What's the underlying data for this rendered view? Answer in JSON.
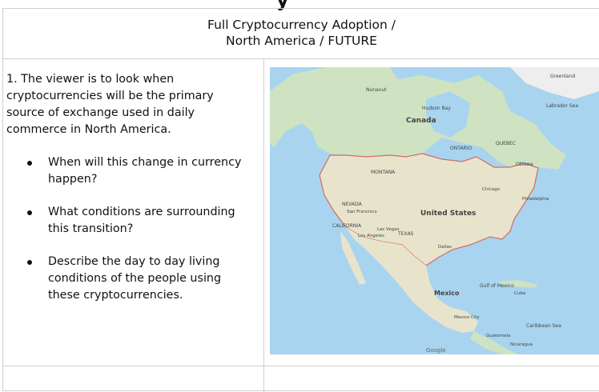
{
  "page": {
    "cutoff_heading": "y"
  },
  "header": {
    "title_line1": "Full Cryptocurrency Adoption /",
    "title_line2": "North America / FUTURE"
  },
  "prompt": {
    "intro": "1. The viewer is to look when cryptocurrencies will be the primary source  of exchange used in daily commerce in North America.",
    "bullets": [
      "When will this change in currency happen?",
      "What conditions are surrounding this transition?",
      "Describe the day to day living conditions of the people using these cryptocurrencies."
    ]
  },
  "map": {
    "labels": {
      "canada": "Canada",
      "united_states": "United States",
      "mexico": "Mexico",
      "hudson_bay": "Hudson Bay",
      "greenland": "Greenland",
      "nunavut": "Nunavut",
      "ontario": "ONTARIO",
      "quebec": "QUEBEC",
      "montana": "MONTANA",
      "nevada": "NEVADA",
      "texas": "TEXAS",
      "california": "CALIFORNIA",
      "san_francisco": "San Francisco",
      "los_angeles": "Los Angeles",
      "las_vegas": "Las Vegas",
      "dallas": "Dallas",
      "chicago": "Chicago",
      "philadelphia": "Philadelphia",
      "ottawa": "Ottawa",
      "mexico_city": "Mexico City",
      "guatemala": "Guatemala",
      "nicaragua": "Nicaragua",
      "gulf_of_mexico": "Gulf of Mexico",
      "caribbean_sea": "Caribbean Sea",
      "labrador_sea": "Labrador Sea",
      "cuba": "Cuba",
      "google": "Google"
    },
    "colors": {
      "water": "#a8d4ef",
      "land": "#e8e4cc",
      "forest": "#cfe3c2",
      "border": "#d46a6a"
    }
  }
}
